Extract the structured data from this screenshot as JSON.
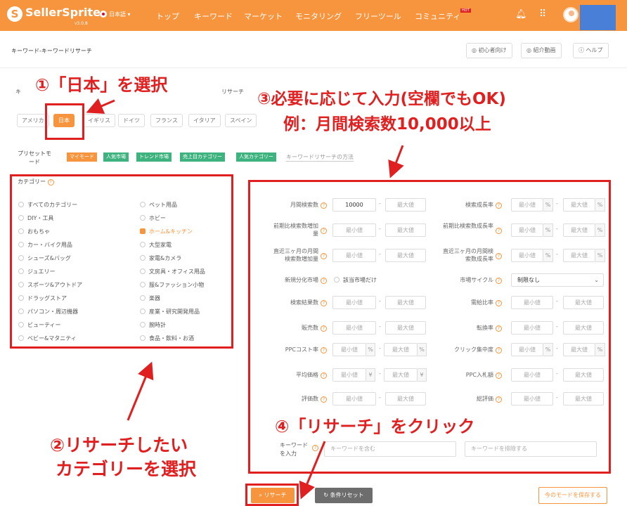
{
  "header": {
    "brand": "SellerSprite",
    "version": "v3.0.8",
    "lang": "日本語 ▾",
    "nav": [
      "トップ",
      "キーワード",
      "マーケット",
      "モニタリング",
      "フリーツール",
      "コミュニティ"
    ],
    "hot_badge": "HOT",
    "colors": {
      "bar": "#f7953e",
      "account_box": "#4a7fd8"
    }
  },
  "subheader": {
    "breadcrumb": "キーワード-キーワードリサーチ",
    "buttons": [
      "初心者向け",
      "紹介動画",
      "ヘルプ"
    ]
  },
  "tabs_fragments": [
    "キ",
    "リサーチ"
  ],
  "countries": [
    "アメリカ",
    "日本",
    "イギリス",
    "ドイツ",
    "フランス",
    "イタリア",
    "スペイン"
  ],
  "preset": {
    "label": "プリセットモード",
    "tags": [
      {
        "label": "マイモード",
        "color": "#f7953e"
      },
      {
        "label": "人気市場",
        "color": "#3fb37f"
      },
      {
        "label": "トレンド市場",
        "color": "#3fb37f"
      },
      {
        "label": "売上目カテゴリー",
        "color": "#3fb37f"
      },
      {
        "label": "人気カテゴリー",
        "color": "#3fb37f"
      }
    ],
    "help": "キーワードリサーチの方法"
  },
  "category": {
    "label": "カテゴリー",
    "left": [
      "すべてのカテゴリー",
      "DIY・工具",
      "おもちゃ",
      "カー・バイク用品",
      "シューズ&バッグ",
      "ジュエリー",
      "スポーツ&アウトドア",
      "ドラッグストア",
      "パソコン・周辺機器",
      "ビューティー",
      "ベビー&マタニティ"
    ],
    "right": [
      "ペット用品",
      "ホビー",
      "ホーム&キッチン",
      "大型家電",
      "家電&カメラ",
      "文房具・オフィス用品",
      "服&ファッション小物",
      "楽器",
      "産業・研究開発用品",
      "腕時計",
      "食品・飲料・お酒"
    ],
    "checked": "ホーム&キッチン"
  },
  "filters": {
    "min": "最小値",
    "max": "最大値",
    "dash": "-",
    "pct": "%",
    "yen": "¥",
    "search_volume": {
      "label": "月間検索数",
      "value": "10000"
    },
    "left_labels": [
      "月間検索数",
      "前期比検索数増加量",
      "直近三ヶ月の月間検索数増加量",
      "新規分化市場",
      "検索結果数",
      "販売数",
      "PPCコスト率",
      "平均価格",
      "評価数"
    ],
    "right_labels": [
      "検索成長率",
      "前期比検索数成長率",
      "直近三ヶ月の月間検索数成長率",
      "市場サイクル",
      "需給比率",
      "転換率",
      "クリック集中度",
      "PPC入札額",
      "総評価"
    ],
    "niche_checkbox": "該当市場だけ",
    "market_cycle": "制限なし"
  },
  "keyword": {
    "label": "キーワードを入力",
    "include_placeholder": "キーワードを含む",
    "exclude_placeholder": "キーワードを排除する"
  },
  "actions": {
    "search": "リサーチ",
    "reset": "条件リセット",
    "save": "今のモードを保存する"
  },
  "annotations": {
    "step1": "①「日本」を選択",
    "step2_line1": "②リサーチしたい",
    "step2_line2": "カテゴリーを選択",
    "step3_line1": "③必要に応じて入力(空欄でもOK)",
    "step3_line2": "例：月間検索数10,000以上",
    "step4": "④「リサーチ」をクリック"
  }
}
